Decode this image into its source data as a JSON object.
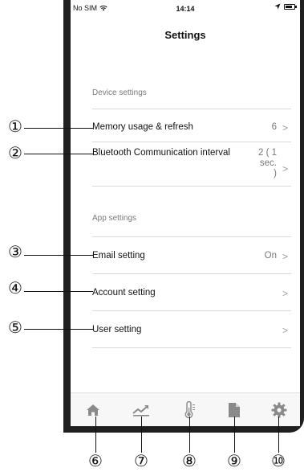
{
  "status": {
    "carrier": "No SIM",
    "time": "14:14"
  },
  "title": "Settings",
  "device_section": {
    "header": "Device settings",
    "memory": {
      "label": "Memory usage & refresh",
      "value": "6"
    },
    "bluetooth": {
      "label": "Bluetooth Communication interval",
      "value_line1": "2 ( 1",
      "value_line2": "sec.",
      "value_line3": ")"
    }
  },
  "app_section": {
    "header": "App settings",
    "email": {
      "label": "Email setting",
      "value": "On"
    },
    "account": {
      "label": "Account setting"
    },
    "user": {
      "label": "User setting"
    }
  },
  "chevron": ">",
  "tabs": [
    "home-icon",
    "trend-chart-icon",
    "thermometer-icon",
    "document-icon",
    "gear-icon"
  ],
  "callouts": [
    "①",
    "②",
    "③",
    "④",
    "⑤",
    "⑥",
    "⑦",
    "⑧",
    "⑨",
    "⑩"
  ]
}
